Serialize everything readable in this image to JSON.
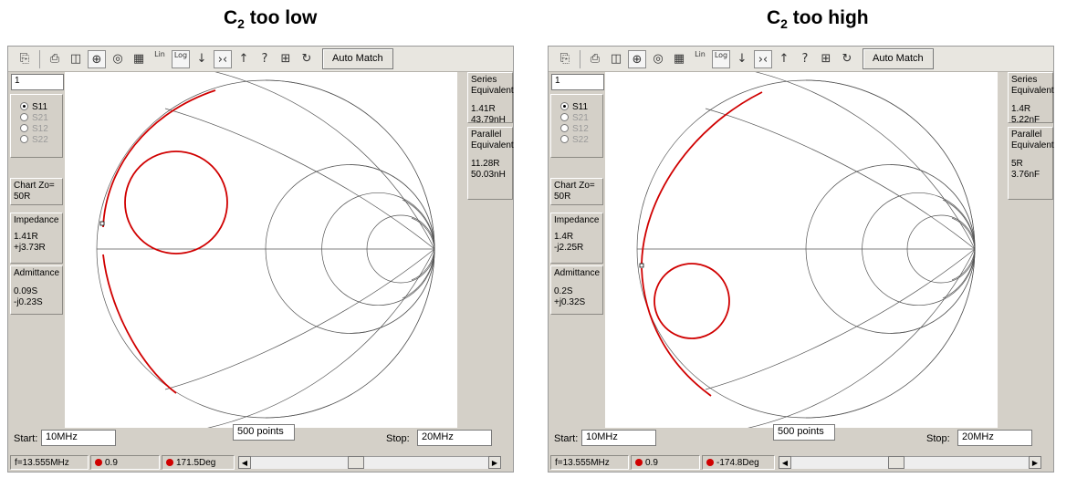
{
  "panels": [
    {
      "caption_main": "C",
      "caption_sub": "2",
      "caption_rest": " too low",
      "toolbar": {
        "auto_match": "Auto Match",
        "lin": "Lin",
        "log": "Log"
      },
      "trace_input": "1",
      "params": [
        "S11",
        "S21",
        "S12",
        "S22"
      ],
      "chart_zo_label": "Chart Zo=",
      "chart_zo_value": "50R",
      "impedance_label": "Impedance",
      "impedance_r": "1.41R",
      "impedance_x": "+j3.73R",
      "admittance_label": "Admittance",
      "admittance_g": "0.09S",
      "admittance_b": "-j0.23S",
      "series_label_1": "Series",
      "series_label_2": "Equivalent",
      "series_v1": "1.41R",
      "series_v2": "43.79nH",
      "parallel_label_1": "Parallel",
      "parallel_label_2": "Equivalent",
      "parallel_v1": "11.28R",
      "parallel_v2": "50.03nH",
      "start_label": "Start:",
      "start_value": "10MHz",
      "points_value": "500 points",
      "stop_label": "Stop:",
      "stop_value": "20MHz",
      "status_freq": "f=13.555MHz",
      "status_mag": "0.9",
      "status_angle": "171.5Deg",
      "marker_color": "#d00000"
    },
    {
      "caption_main": "C",
      "caption_sub": "2",
      "caption_rest": " too high",
      "toolbar": {
        "auto_match": "Auto Match",
        "lin": "Lin",
        "log": "Log"
      },
      "trace_input": "1",
      "params": [
        "S11",
        "S21",
        "S12",
        "S22"
      ],
      "chart_zo_label": "Chart Zo=",
      "chart_zo_value": "50R",
      "impedance_label": "Impedance",
      "impedance_r": "1.4R",
      "impedance_x": "-j2.25R",
      "admittance_label": "Admittance",
      "admittance_g": "0.2S",
      "admittance_b": "+j0.32S",
      "series_label_1": "Series",
      "series_label_2": "Equivalent",
      "series_v1": "1.4R",
      "series_v2": "5.22nF",
      "parallel_label_1": "Parallel",
      "parallel_label_2": "Equivalent",
      "parallel_v1": "5R",
      "parallel_v2": "3.76nF",
      "start_label": "Start:",
      "start_value": "10MHz",
      "points_value": "500 points",
      "stop_label": "Stop:",
      "stop_value": "20MHz",
      "status_freq": "f=13.555MHz",
      "status_mag": "0.9",
      "status_angle": "-174.8Deg",
      "marker_color": "#d00000"
    }
  ]
}
